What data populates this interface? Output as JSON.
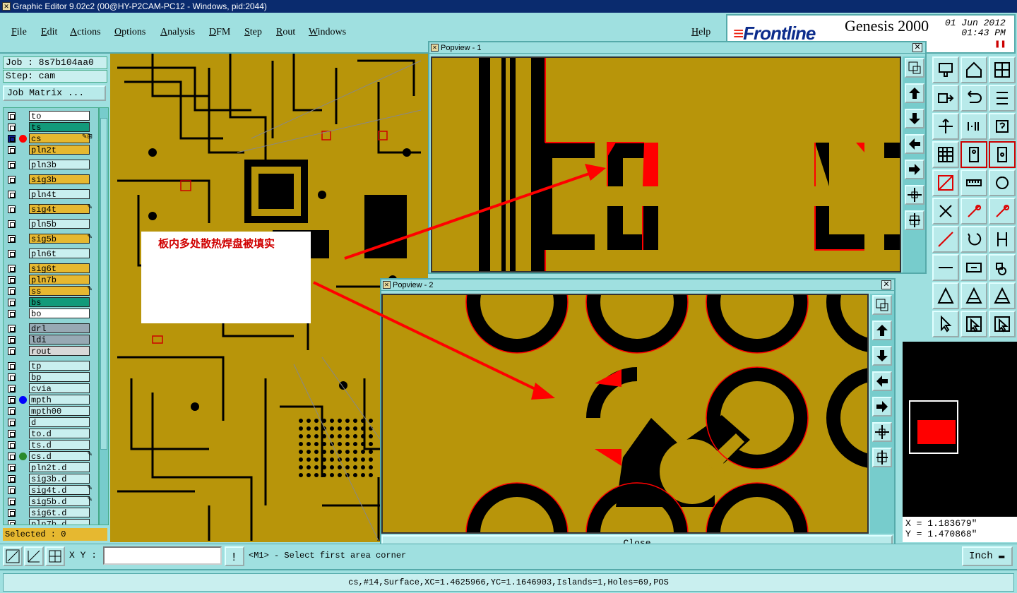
{
  "window": {
    "title": "Graphic Editor 9.02c2 (00@HY-P2CAM-PC12 - Windows, pid:2044)"
  },
  "menu": [
    "File",
    "Edit",
    "Actions",
    "Options",
    "Analysis",
    "DFM",
    "Step",
    "Rout",
    "Windows"
  ],
  "help": "Help",
  "brand": {
    "logo": "Frontline",
    "product": "Genesis 2000",
    "date": "01 Jun 2012",
    "time": "01:43 PM"
  },
  "job": {
    "job_text": "Job : 8s7b104aa0",
    "step_text": "Step: cam",
    "matrix_button": "Job Matrix ..."
  },
  "layers": [
    {
      "name": "to",
      "color": "#ffffff",
      "dot": null,
      "mark": ""
    },
    {
      "name": "ts",
      "color": "#129a7a",
      "dot": null,
      "mark": ""
    },
    {
      "name": "cs",
      "color": "#e6b830",
      "dot": "#ff0000",
      "mark": "✎⊞",
      "work": true
    },
    {
      "name": "pln2t",
      "color": "#e6b830",
      "dot": null,
      "mark": ""
    },
    {
      "name": "pln3b",
      "color": "#c9efef",
      "dot": null,
      "mark": ""
    },
    {
      "name": "sig3b",
      "color": "#e6b830",
      "dot": null,
      "mark": ""
    },
    {
      "name": "pln4t",
      "color": "#c9efef",
      "dot": null,
      "mark": ""
    },
    {
      "name": "sig4t",
      "color": "#e6b830",
      "dot": null,
      "mark": "✎"
    },
    {
      "name": "pln5b",
      "color": "#c9efef",
      "dot": null,
      "mark": ""
    },
    {
      "name": "sig5b",
      "color": "#e6b830",
      "dot": null,
      "mark": "✎"
    },
    {
      "name": "pln6t",
      "color": "#c9efef",
      "dot": null,
      "mark": ""
    },
    {
      "name": "sig6t",
      "color": "#e6b830",
      "dot": null,
      "mark": ""
    },
    {
      "name": "pln7b",
      "color": "#e6b830",
      "dot": null,
      "mark": ""
    },
    {
      "name": "ss",
      "color": "#e6b830",
      "dot": null,
      "mark": "✎"
    },
    {
      "name": "bs",
      "color": "#129a7a",
      "dot": null,
      "mark": ""
    },
    {
      "name": "bo",
      "color": "#ffffff",
      "dot": null,
      "mark": ""
    },
    {
      "name": "drl",
      "color": "#97a9b4",
      "dot": null,
      "mark": ""
    },
    {
      "name": "ldi",
      "color": "#97a9b4",
      "dot": null,
      "mark": ""
    },
    {
      "name": "rout",
      "color": "#d8d8d8",
      "dot": null,
      "mark": ""
    },
    {
      "name": "tp",
      "color": "#c9efef",
      "dot": null,
      "mark": ""
    },
    {
      "name": "bp",
      "color": "#c9efef",
      "dot": null,
      "mark": ""
    },
    {
      "name": "cvia",
      "color": "#c9efef",
      "dot": null,
      "mark": ""
    },
    {
      "name": "mpth",
      "color": "#c9efef",
      "dot": "#0000ff",
      "mark": ""
    },
    {
      "name": "mpth00",
      "color": "#c9efef",
      "dot": null,
      "mark": ""
    },
    {
      "name": "d",
      "color": "#c9efef",
      "dot": null,
      "mark": ""
    },
    {
      "name": "to.d",
      "color": "#c9efef",
      "dot": null,
      "mark": ""
    },
    {
      "name": "ts.d",
      "color": "#c9efef",
      "dot": null,
      "mark": ""
    },
    {
      "name": "cs.d",
      "color": "#c9efef",
      "dot": "#2a8a2a",
      "mark": "✎"
    },
    {
      "name": "pln2t.d",
      "color": "#c9efef",
      "dot": null,
      "mark": ""
    },
    {
      "name": "sig3b.d",
      "color": "#c9efef",
      "dot": null,
      "mark": ""
    },
    {
      "name": "sig4t.d",
      "color": "#c9efef",
      "dot": null,
      "mark": "✎"
    },
    {
      "name": "sig5b.d",
      "color": "#c9efef",
      "dot": null,
      "mark": "✎"
    },
    {
      "name": "sig6t.d",
      "color": "#c9efef",
      "dot": null,
      "mark": ""
    },
    {
      "name": "pln7b.d",
      "color": "#c9efef",
      "dot": null,
      "mark": ""
    }
  ],
  "selected_text": "Selected : 0",
  "annotation": "板内多处散热焊盘被填实",
  "popview1": {
    "title": "Popview - 1"
  },
  "popview2": {
    "title": "Popview - 2"
  },
  "close_label": "Close",
  "coords": {
    "x_text": "X = 1.183679\"",
    "y_text": "Y = 1.470868\""
  },
  "bottom": {
    "xy_label": "X Y :",
    "xy_value": "",
    "prompt": "<M1> - Select first area corner",
    "units": "Inch"
  },
  "status": "cs,#14,Surface,XC=1.4625966,YC=1.1646903,Islands=1,Holes=69,POS",
  "colors": {
    "copper": "#b8950a",
    "panel": "#9fe0e0",
    "highlight": "#ff0000"
  }
}
